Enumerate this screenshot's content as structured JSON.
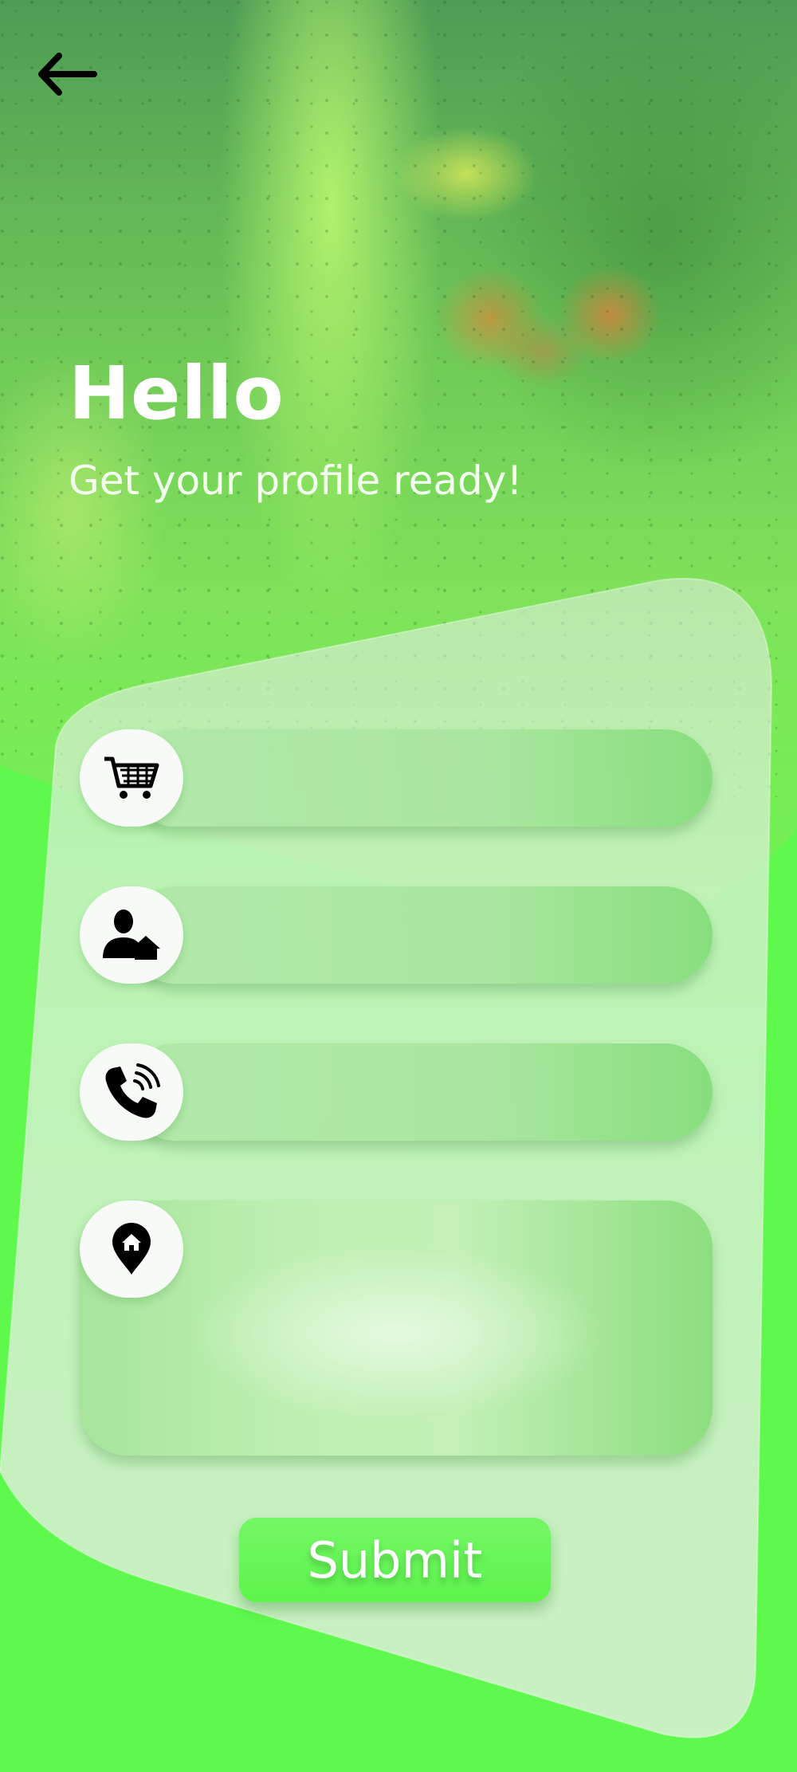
{
  "header": {
    "title": "Hello",
    "subtitle": "Get your profile ready!",
    "back_icon": "arrow-left-icon"
  },
  "form": {
    "fields": [
      {
        "name": "shop-name-field",
        "icon": "shopping-cart-icon",
        "value": "",
        "placeholder": ""
      },
      {
        "name": "owner-name-field",
        "icon": "person-home-icon",
        "value": "",
        "placeholder": ""
      },
      {
        "name": "phone-field",
        "icon": "phone-ringing-icon",
        "value": "",
        "placeholder": ""
      }
    ],
    "address": {
      "icon": "home-location-pin-icon",
      "value": "",
      "placeholder": ""
    },
    "submit_label": "Submit"
  },
  "colors": {
    "accent": "#5ef94c",
    "field": "#a8e69c",
    "card": "#d6f0d2",
    "icon_bg": "#f7faf7",
    "text": "#ffffff"
  }
}
